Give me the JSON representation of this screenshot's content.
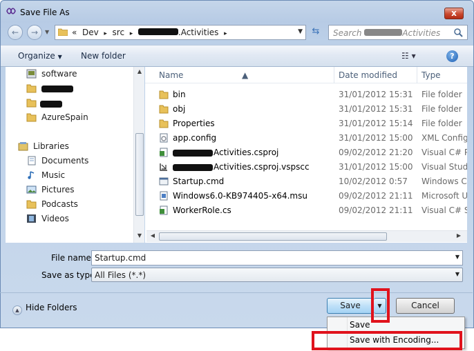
{
  "window": {
    "title": "Save File As",
    "close_glyph": "x"
  },
  "address": {
    "prefix": "«",
    "crumbs": [
      "Dev",
      "src",
      ".Activities"
    ],
    "separator": "▸"
  },
  "search": {
    "placeholder_start": "Search",
    "placeholder_end": "Activities"
  },
  "toolbar": {
    "organize_label": "Organize",
    "new_folder_label": "New folder",
    "views_glyph": "☷ ▾",
    "help_glyph": "?"
  },
  "nav": {
    "items": [
      {
        "label": "software",
        "icon": "software-icon"
      },
      {
        "label": "",
        "icon": "folder-icon",
        "redacted": true
      },
      {
        "label": "",
        "icon": "folder-icon",
        "redacted": true
      },
      {
        "label": "AzureSpain",
        "icon": "folder-icon"
      },
      {
        "label": "Libraries",
        "icon": "libraries-icon"
      },
      {
        "label": "Documents",
        "icon": "documents-icon"
      },
      {
        "label": "Music",
        "icon": "music-icon"
      },
      {
        "label": "Pictures",
        "icon": "pictures-icon"
      },
      {
        "label": "Podcasts",
        "icon": "folder-icon"
      },
      {
        "label": "Videos",
        "icon": "videos-icon"
      }
    ]
  },
  "files": {
    "columns": [
      "Name",
      "Date modified",
      "Type"
    ],
    "rows": [
      {
        "name": "bin",
        "date": "31/01/2012 15:31",
        "type": "File folder",
        "icon": "folder-icon"
      },
      {
        "name": "obj",
        "date": "31/01/2012 15:31",
        "type": "File folder",
        "icon": "folder-icon"
      },
      {
        "name": "Properties",
        "date": "31/01/2012 15:14",
        "type": "File folder",
        "icon": "folder-icon"
      },
      {
        "name": "app.config",
        "date": "31/01/2012 15:00",
        "type": "XML Configu",
        "icon": "config-file-icon"
      },
      {
        "name": "Activities.csproj",
        "date": "09/02/2012 21:20",
        "type": "Visual C# Pro",
        "icon": "csproj-file-icon",
        "redacted": true
      },
      {
        "name": "Activities.csproj.vspscc",
        "date": "31/01/2012 15:00",
        "type": "Visual Studio",
        "icon": "vspscc-file-icon",
        "redacted": true
      },
      {
        "name": "Startup.cmd",
        "date": "10/02/2012 0:57",
        "type": "Windows Co",
        "icon": "cmd-file-icon"
      },
      {
        "name": "Windows6.0-KB974405-x64.msu",
        "date": "09/02/2012 21:11",
        "type": "Microsoft Up",
        "icon": "msu-file-icon"
      },
      {
        "name": "WorkerRole.cs",
        "date": "09/02/2012 21:11",
        "type": "Visual C# So",
        "icon": "cs-file-icon"
      }
    ]
  },
  "form": {
    "file_name_label": "File name:",
    "file_name_value": "Startup.cmd",
    "save_as_type_label": "Save as type:",
    "save_as_type_value": "All Files (*.*)"
  },
  "buttons": {
    "hide_folders_label": "Hide Folders",
    "save_label": "Save",
    "cancel_label": "Cancel"
  },
  "save_menu": {
    "items": [
      "Save",
      "Save with Encoding..."
    ]
  },
  "colors": {
    "highlight": "#e0121c",
    "accent": "#3c7fb1"
  }
}
